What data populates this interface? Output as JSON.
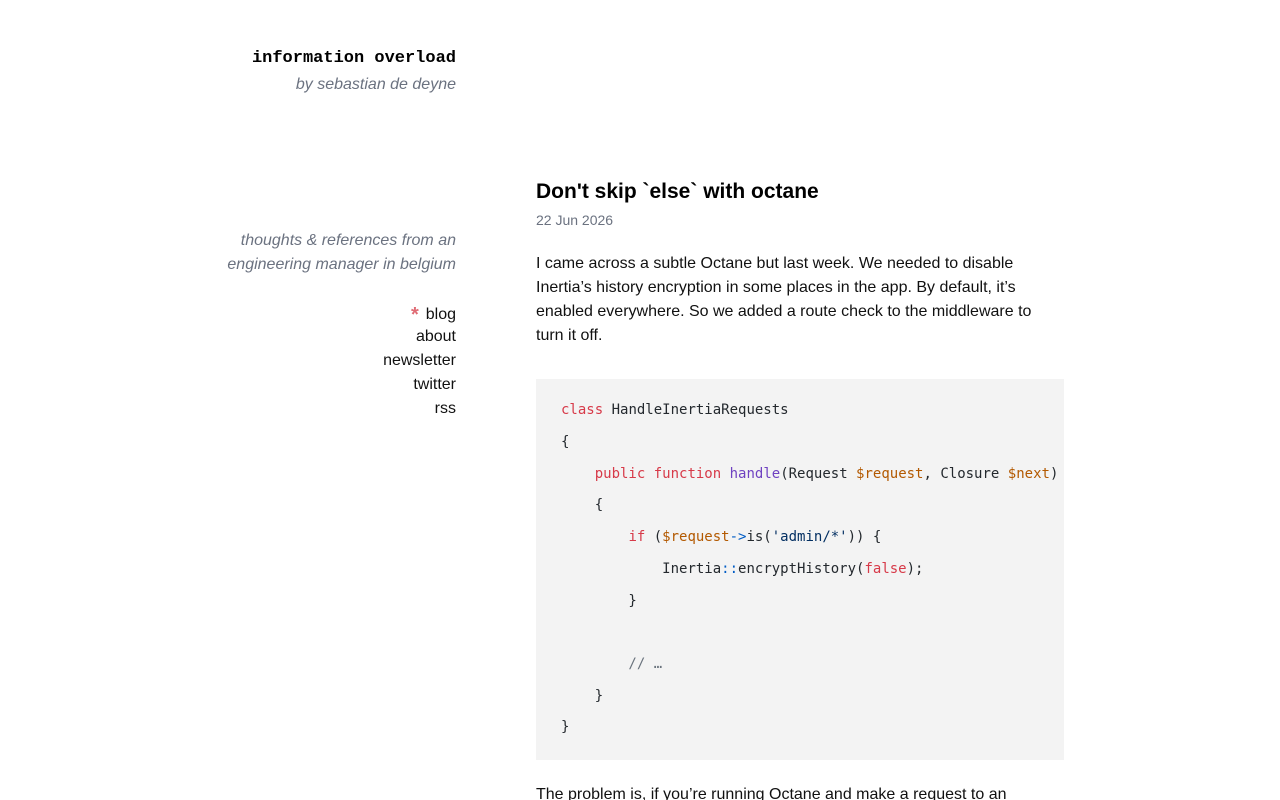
{
  "site": {
    "title": "information overload",
    "byline": "by sebastian de deyne",
    "tagline_lines": [
      "thoughts & references from an",
      "engineering manager in belgium"
    ]
  },
  "nav": {
    "active_marker": "*",
    "items": [
      {
        "label": "blog",
        "active": true
      },
      {
        "label": "about",
        "active": false
      },
      {
        "label": "newsletter",
        "active": false
      },
      {
        "label": "twitter",
        "active": false
      },
      {
        "label": "rss",
        "active": false
      }
    ]
  },
  "post": {
    "title": "Don't skip `else` with octane",
    "date": "22 Jun 2026",
    "intro_lines": [
      "I came across a subtle Octane but last week. We needed to disable",
      "Inertia’s history encryption in some places in the app. By default, it’s",
      "enabled everywhere. So we added a route check to the middleware to",
      "turn it off."
    ],
    "code": {
      "language": "php",
      "line_1": {
        "kw": "class",
        "name": " HandleInertiaRequests"
      },
      "line_2": "{",
      "line_3": {
        "indent": "    ",
        "kw_public": "public",
        "kw_function": "function",
        "fn": "handle",
        "open": "(Request ",
        "var_request": "$request",
        "mid": ", Closure ",
        "var_next": "$next",
        "close": ")"
      },
      "line_4": "    {",
      "line_5": {
        "indent": "        ",
        "kw": "if",
        "open": " (",
        "var": "$request",
        "op": "->",
        "call": "is(",
        "str": "'admin/*'",
        "close": ")) {"
      },
      "line_6": {
        "indent": "            ",
        "class": "Inertia",
        "op": "::",
        "call": "encryptHistory(",
        "kw": "false",
        "close": ");"
      },
      "line_7": "        }",
      "line_8": "",
      "line_9": "        // …",
      "line_10": "    }",
      "line_11": "}"
    },
    "next_paragraph_start": "The problem is, if you’re running Octane and make a request to an"
  },
  "colors": {
    "accent_star": "#e06c75",
    "muted_text": "#6b7280",
    "code_bg": "#f3f3f3",
    "code_keyword": "#d73a49",
    "code_function": "#6f42c1",
    "code_variable": "#b35900",
    "code_operator": "#005cc5",
    "code_string": "#032f62"
  }
}
